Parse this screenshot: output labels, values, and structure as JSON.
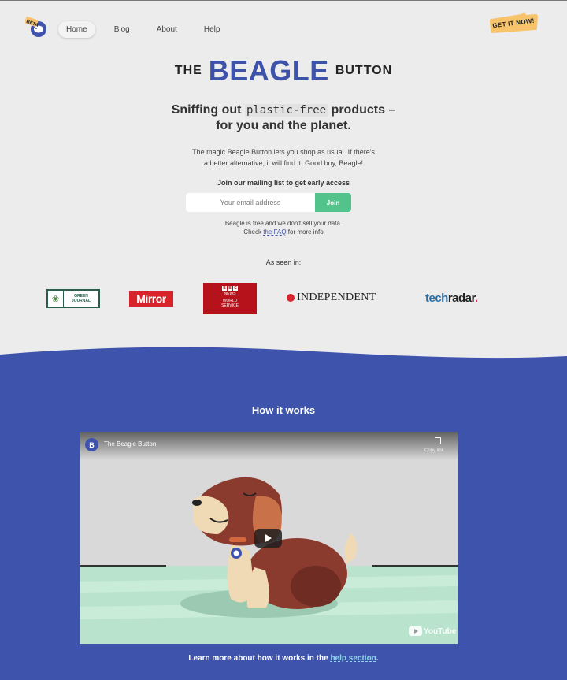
{
  "nav": {
    "beta_badge": "BETA",
    "links": [
      {
        "label": "Home",
        "active": true
      },
      {
        "label": "Blog",
        "active": false
      },
      {
        "label": "About",
        "active": false
      },
      {
        "label": "Help",
        "active": false
      }
    ],
    "cta": "GET IT NOW!"
  },
  "brand": {
    "prefix": "THE",
    "name": "BEAGLE",
    "suffix": "BUTTON",
    "color": "#3d52a8"
  },
  "hero": {
    "headline_pre": "Sniffing out ",
    "headline_highlight": "plastic-free",
    "headline_post": " products –",
    "headline_line2": "for you and the planet.",
    "intro_line1": "The magic Beagle Button lets you shop as usual. If there's",
    "intro_line2": "a better alternative, it will find it. Good boy, Beagle!"
  },
  "signup": {
    "label": "Join our mailing list to get early access",
    "email_placeholder": "Your email address",
    "email_value": "",
    "button": "Join",
    "button_color": "#52c48b",
    "privacy_line1": "Beagle is free and we don't sell your data.",
    "privacy_check": "Check ",
    "privacy_faq": "the FAQ",
    "privacy_more": " for more info"
  },
  "press": {
    "title": "As seen in:",
    "green_journal_top": "GREEN",
    "green_journal_bottom": "JOURNAL",
    "mirror": "Mirror",
    "bbc_boxes": [
      "B",
      "B",
      "C"
    ],
    "bbc_line1": "NEWS",
    "bbc_line2": "WORLD",
    "bbc_line3": "SERVICE",
    "independent": "INDEPENDENT",
    "techradar_tech": "tech",
    "techradar_radar": "radar",
    "techradar_dot": "."
  },
  "how": {
    "title": "How it works",
    "video_channel_initial": "B",
    "video_title": "The Beagle Button",
    "copy_link": "Copy link",
    "youtube_label": "YouTube",
    "section_color": "#3e53ab"
  },
  "footer": {
    "learn_pre": "Learn more about how it works in the ",
    "help_link": "help section",
    "learn_post": "."
  }
}
